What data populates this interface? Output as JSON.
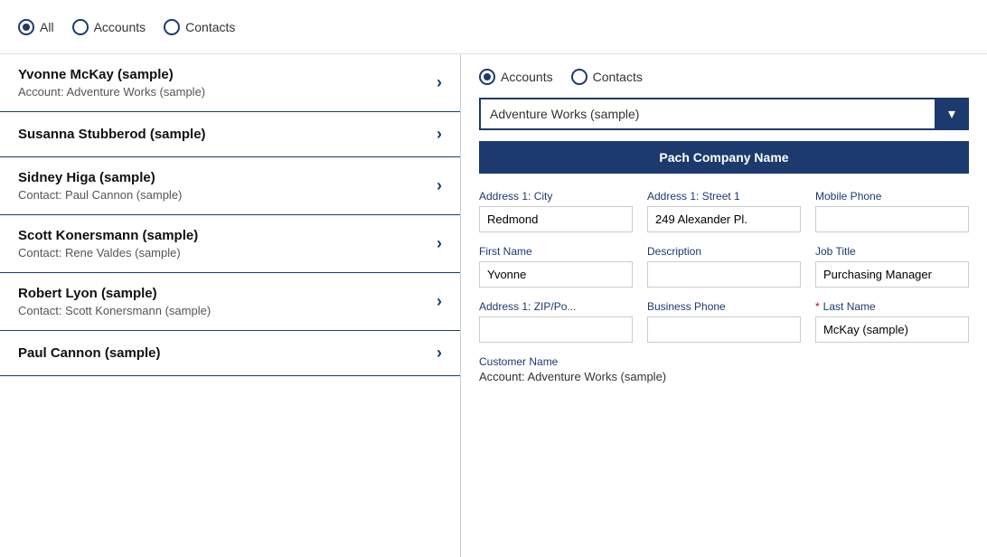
{
  "topBar": {
    "filters": [
      {
        "id": "all",
        "label": "All",
        "selected": true
      },
      {
        "id": "accounts",
        "label": "Accounts",
        "selected": false
      },
      {
        "id": "contacts",
        "label": "Contacts",
        "selected": false
      }
    ]
  },
  "leftPanel": {
    "items": [
      {
        "name": "Yvonne McKay (sample)",
        "sub": "Account: Adventure Works (sample)"
      },
      {
        "name": "Susanna Stubberod (sample)",
        "sub": ""
      },
      {
        "name": "Sidney Higa (sample)",
        "sub": "Contact: Paul Cannon (sample)"
      },
      {
        "name": "Scott Konersmann (sample)",
        "sub": "Contact: Rene Valdes (sample)"
      },
      {
        "name": "Robert Lyon (sample)",
        "sub": "Contact: Scott Konersmann (sample)"
      },
      {
        "name": "Paul Cannon (sample)",
        "sub": ""
      }
    ]
  },
  "rightPanel": {
    "radioFilters": [
      {
        "id": "accounts",
        "label": "Accounts",
        "selected": true
      },
      {
        "id": "contacts",
        "label": "Contacts",
        "selected": false
      }
    ],
    "dropdown": {
      "value": "Adventure Works (sample)",
      "options": [
        "Adventure Works (sample)"
      ]
    },
    "patchButton": "Pach Company Name",
    "formFields": [
      {
        "label": "Address 1: City",
        "value": "Redmond",
        "required": false,
        "id": "city"
      },
      {
        "label": "Address 1: Street 1",
        "value": "249 Alexander Pl.",
        "required": false,
        "id": "street1"
      },
      {
        "label": "Mobile Phone",
        "value": "",
        "required": false,
        "id": "mobile"
      },
      {
        "label": "First Name",
        "value": "Yvonne",
        "required": false,
        "id": "firstname"
      },
      {
        "label": "Description",
        "value": "",
        "required": false,
        "id": "description"
      },
      {
        "label": "Job Title",
        "value": "Purchasing Manager",
        "required": false,
        "id": "jobtitle"
      },
      {
        "label": "Address 1: ZIP/Po...",
        "value": "",
        "required": false,
        "id": "zip"
      },
      {
        "label": "Business Phone",
        "value": "",
        "required": false,
        "id": "bizphone"
      },
      {
        "label": "Last Name",
        "value": "McKay (sample)",
        "required": true,
        "id": "lastname"
      }
    ],
    "customerNameSection": {
      "label": "Customer Name",
      "value": "Account: Adventure Works (sample)"
    }
  }
}
